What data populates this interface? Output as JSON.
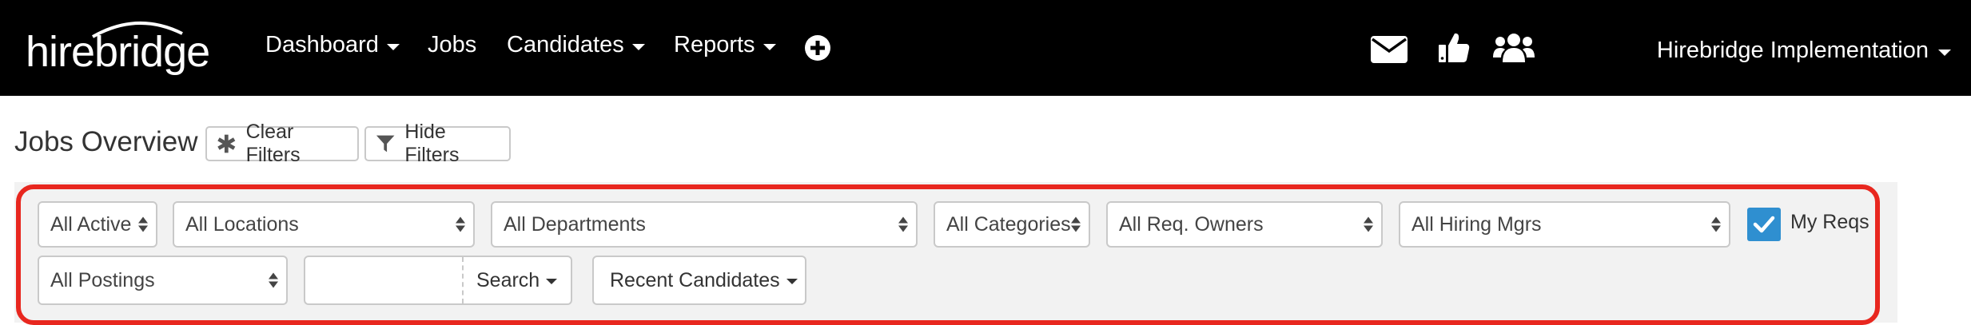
{
  "app": {
    "logo_text": "hirebridge",
    "nav": {
      "dashboard": "Dashboard",
      "jobs": "Jobs",
      "candidates": "Candidates",
      "reports": "Reports"
    },
    "icons": [
      "plus-circle-icon",
      "envelope-icon",
      "thumbs-up-icon",
      "users-icon"
    ],
    "user_menu": "Hirebridge Implementation"
  },
  "header": {
    "title": "Jobs Overview",
    "clear_filters": "Clear Filters",
    "hide_filters": "Hide Filters"
  },
  "filters": {
    "status": "All Active",
    "locations": "All Locations",
    "departments": "All Departments",
    "categories": "All Categories",
    "req_owners": "All Req. Owners",
    "hiring_mgrs": "All Hiring Mgrs",
    "my_reqs": {
      "label": "My Reqs",
      "checked": true
    },
    "postings": "All Postings",
    "search": {
      "value": "",
      "button": "Search"
    },
    "recent_candidates": "Recent Candidates"
  },
  "colors": {
    "topbar": "#000000",
    "accent_checkbox": "#2f8fd0",
    "highlight_outline": "#e8271f",
    "panel": "#f2f2f2"
  }
}
